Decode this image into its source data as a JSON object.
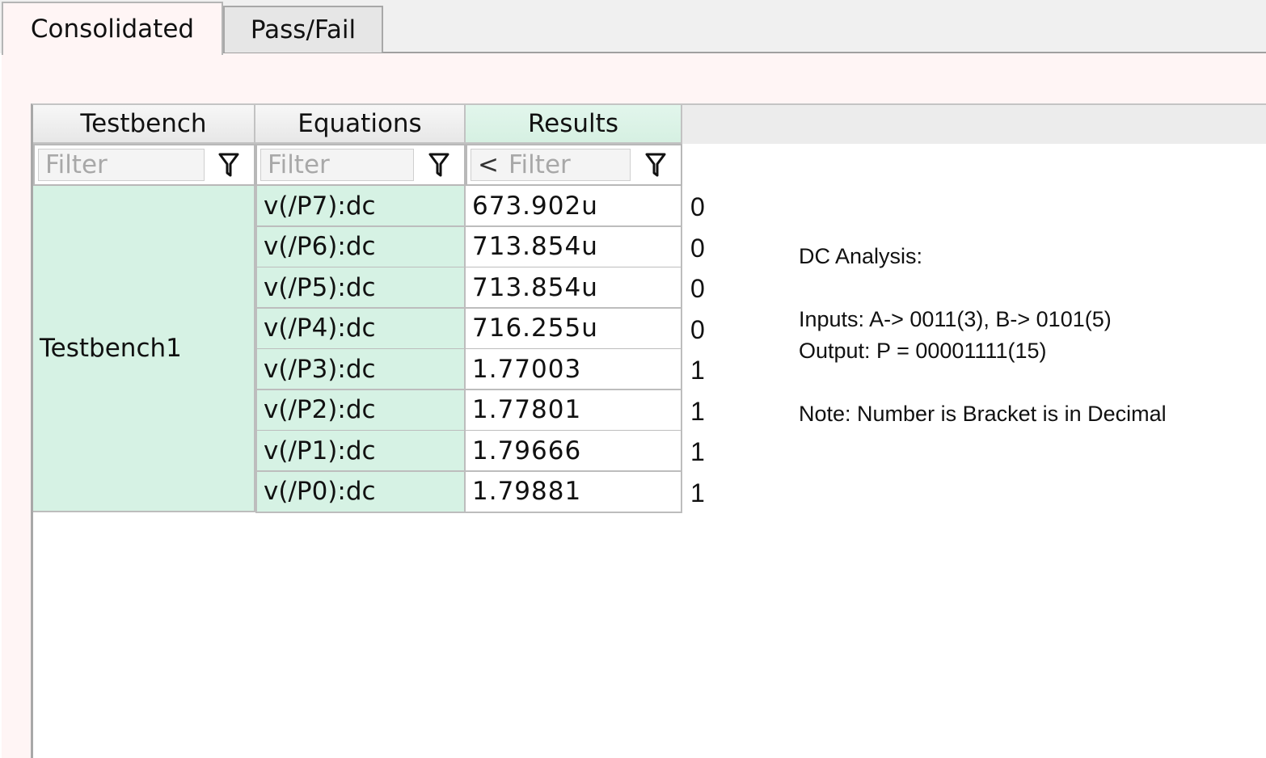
{
  "tabs": [
    {
      "label": "Consolidated",
      "active": true
    },
    {
      "label": "Pass/Fail",
      "active": false
    }
  ],
  "columns": {
    "testbench": "Testbench",
    "equations": "Equations",
    "results": "Results"
  },
  "filters": {
    "testbench_placeholder": "Filter",
    "equations_placeholder": "Filter",
    "results_placeholder": "Filter",
    "results_operator": "<"
  },
  "testbench_name": "Testbench1",
  "rows": [
    {
      "equation": "v(/P7):dc",
      "result": "673.902u",
      "bit": "0"
    },
    {
      "equation": "v(/P6):dc",
      "result": "713.854u",
      "bit": "0"
    },
    {
      "equation": "v(/P5):dc",
      "result": "713.854u",
      "bit": "0"
    },
    {
      "equation": "v(/P4):dc",
      "result": "716.255u",
      "bit": "0"
    },
    {
      "equation": "v(/P3):dc",
      "result": "1.77003",
      "bit": "1"
    },
    {
      "equation": "v(/P2):dc",
      "result": "1.77801",
      "bit": "1"
    },
    {
      "equation": "v(/P1):dc",
      "result": "1.79666",
      "bit": "1"
    },
    {
      "equation": "v(/P0):dc",
      "result": "1.79881",
      "bit": "1"
    }
  ],
  "note": {
    "title": "DC Analysis:",
    "inputs": "Inputs: A-> 0011(3), B-> 0101(5)",
    "output": "Output: P = 00001111(15)",
    "remark": "Note: Number is Bracket is in Decimal"
  },
  "colors": {
    "selected_cell": "#d6f2e4",
    "pane_background": "#fff5f5"
  },
  "icons": {
    "filter": "funnel-icon"
  }
}
